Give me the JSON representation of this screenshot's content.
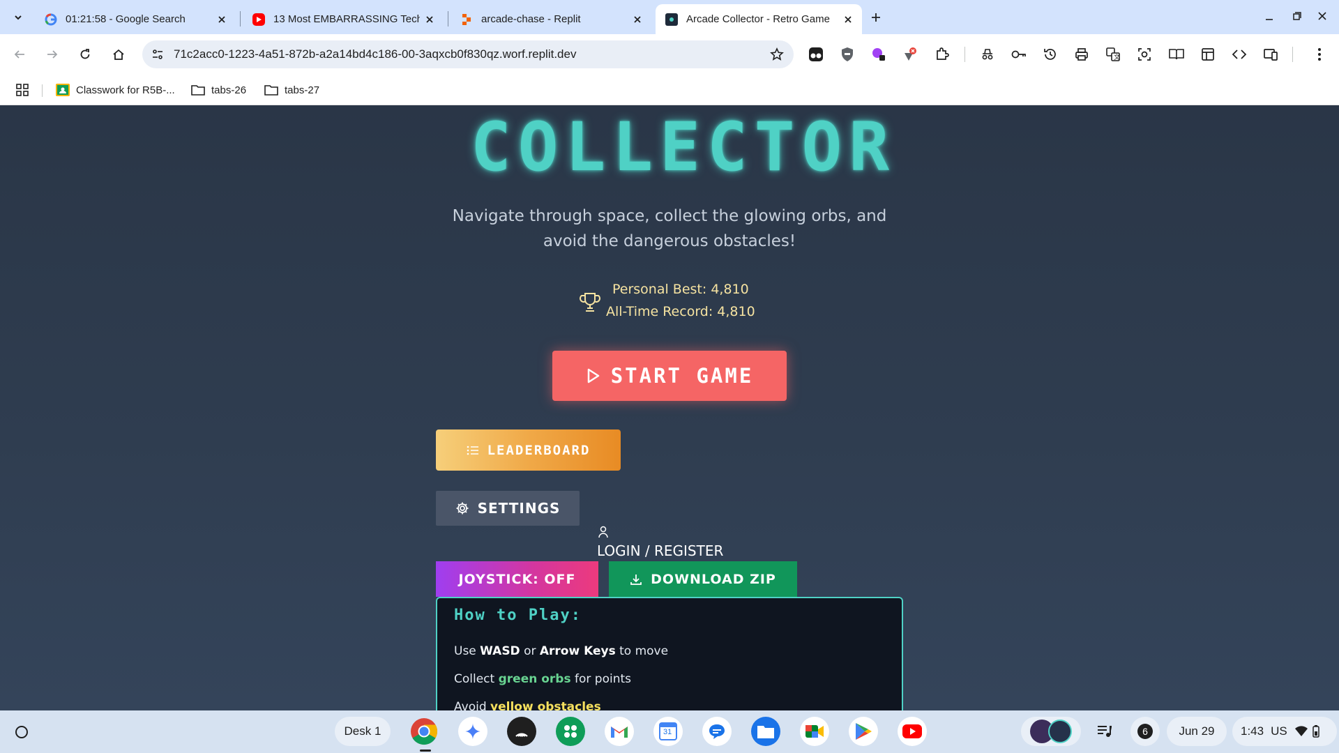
{
  "browser": {
    "tabs": [
      {
        "title": "01:21:58 - Google Search",
        "icon": "google-icon"
      },
      {
        "title": "13 Most EMBARRASSING Tech",
        "icon": "youtube-icon"
      },
      {
        "title": "arcade-chase - Replit",
        "icon": "replit-icon"
      },
      {
        "title": "Arcade Collector - Retro Game",
        "icon": "app-icon",
        "active": true
      }
    ],
    "url": "71c2acc0-1223-4a51-872b-a2a14bd4c186-00-3aqxcb0f830qz.worf.replit.dev",
    "bookmarks": [
      {
        "label": "Classwork for R5B-...",
        "icon": "classroom-icon"
      },
      {
        "label": "tabs-26",
        "icon": "folder-icon"
      },
      {
        "label": "tabs-27",
        "icon": "folder-icon"
      }
    ]
  },
  "game": {
    "title": "COLLECTOR",
    "subtitle_line1": "Navigate through space, collect the glowing orbs, and",
    "subtitle_line2": "avoid the dangerous obstacles!",
    "personal_best": "Personal Best: 4,810",
    "all_time_record": "All-Time Record: 4,810",
    "start_label": "START GAME",
    "leaderboard_label": "LEADERBOARD",
    "settings_label": "SETTINGS",
    "login_label": "LOGIN / REGISTER",
    "joystick_label": "JOYSTICK: OFF",
    "download_label": "DOWNLOAD ZIP",
    "how_to": {
      "heading": "How to Play:",
      "move_pre": "Use",
      "move_key1": "WASD",
      "move_or": "or",
      "move_key2": "Arrow Keys",
      "move_post": "to move",
      "collect_pre": "Collect",
      "collect_item": "green orbs",
      "collect_post": "for points",
      "avoid_pre": "Avoid",
      "avoid_item": "yellow obstacles"
    },
    "colors": {
      "accent": "#4fd1c5",
      "start": "#f56565",
      "download": "#11965a",
      "record": "#f6e3a1"
    }
  },
  "shelf": {
    "desk_label": "Desk 1",
    "apps": [
      "chrome-icon",
      "gemini-icon",
      "podcasts-icon",
      "app-launcher-icon",
      "gmail-icon",
      "calendar-icon",
      "messages-icon",
      "files-icon",
      "meet-icon",
      "play-store-icon",
      "youtube-icon"
    ],
    "calendar_day": "31",
    "notification_count": "6",
    "date": "Jun 29",
    "time": "1:43",
    "locale": "US"
  }
}
